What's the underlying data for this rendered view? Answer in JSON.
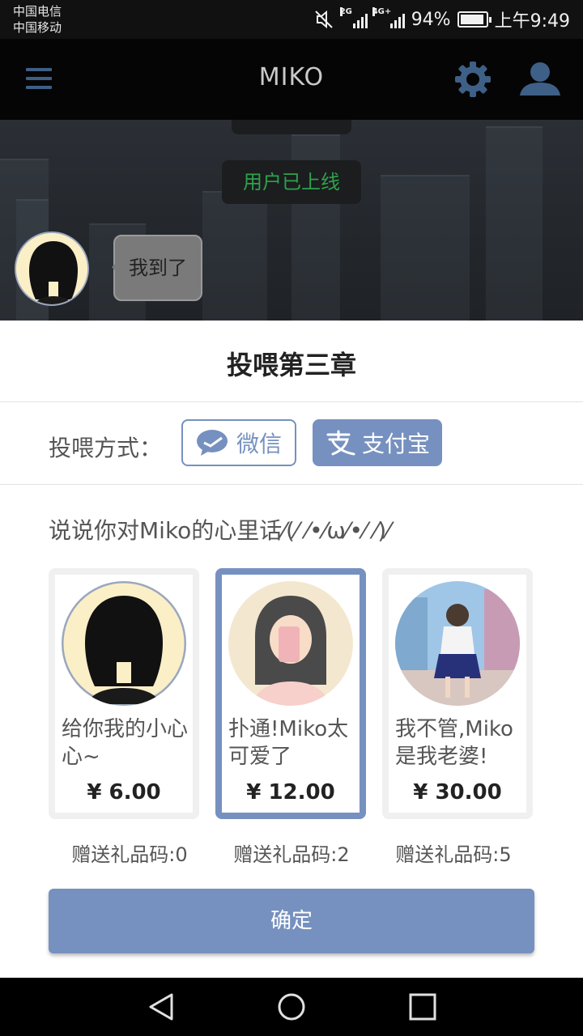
{
  "statusbar": {
    "carrier1": "中国电信",
    "carrier2": "中国移动",
    "net1": "2G",
    "net2": "4G+",
    "battery_pct": "94%",
    "battery_level": 0.94,
    "time": "上午9:49"
  },
  "appbar": {
    "title": "MIKO"
  },
  "chat": {
    "notice": "用户已上线",
    "message": "我到了"
  },
  "sheet": {
    "title": "投喂第三章",
    "pay_label": "投喂方式：",
    "wechat_label": "微信",
    "alipay_label": "支付宝",
    "prompt": "说说你对Miko的心里话⁄(⁄ ⁄•⁄ω⁄•⁄ ⁄)⁄",
    "options": [
      {
        "caption": "给你我的小心心~",
        "price": "¥ 6.00",
        "gift": "赠送礼品码:0"
      },
      {
        "caption": "扑通!Miko太可爱了",
        "price": "¥ 12.00",
        "gift": "赠送礼品码:2"
      },
      {
        "caption": "我不管,Miko是我老婆!",
        "price": "¥ 30.00",
        "gift": "赠送礼品码:5"
      }
    ],
    "confirm_label": "确定"
  },
  "colors": {
    "accent": "#7691bf",
    "online_green": "#2ea24a",
    "appbar_icon": "#3e5f86"
  },
  "icons": [
    "menu-icon",
    "gear-icon",
    "user-icon",
    "wechat-icon",
    "alipay-icon",
    "back-icon",
    "home-icon",
    "recents-icon"
  ]
}
